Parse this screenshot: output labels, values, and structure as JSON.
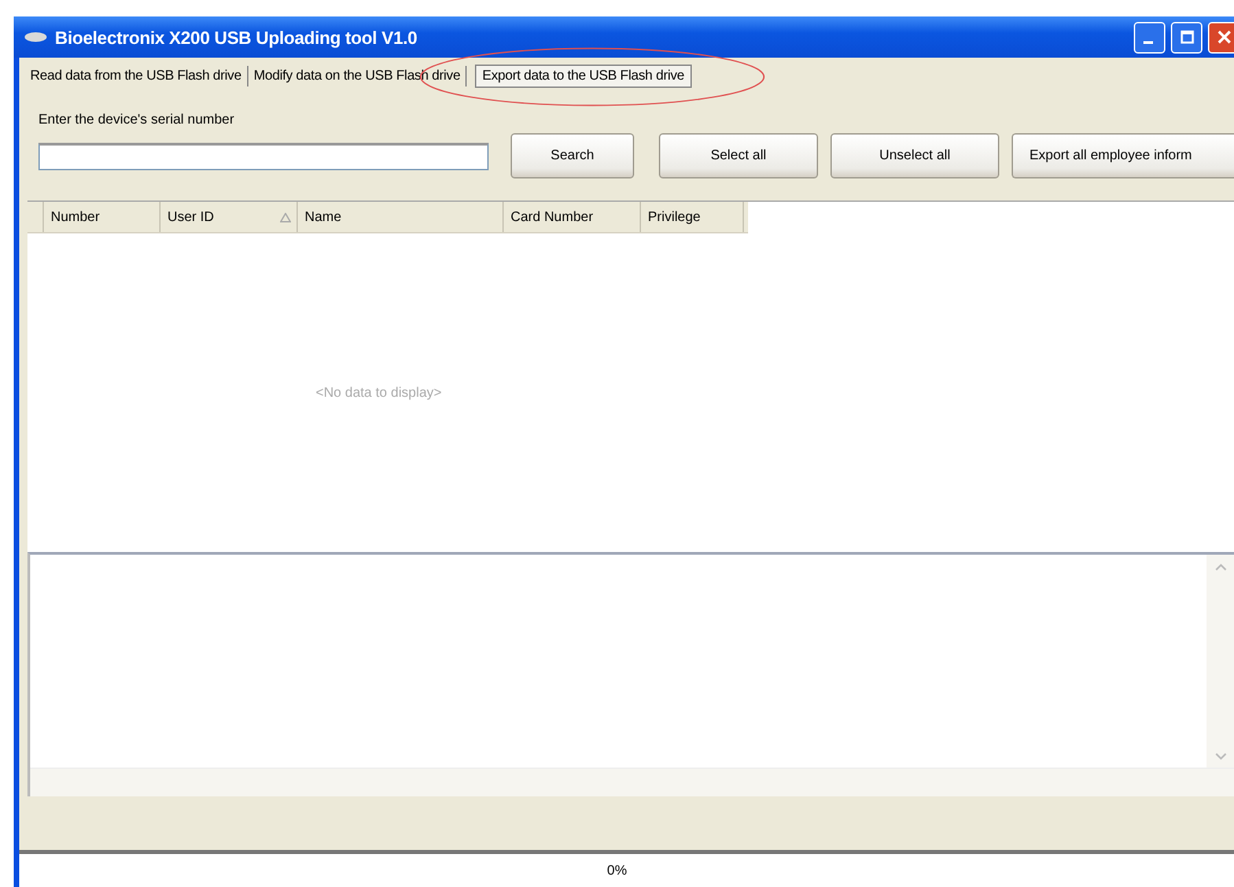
{
  "window": {
    "title": "Bioelectronix X200 USB Uploading tool V1.0"
  },
  "tabs": [
    {
      "label": "Read data from the USB Flash drive",
      "selected": false
    },
    {
      "label": "Modify data on the USB Flash drive",
      "selected": false
    },
    {
      "label": "Export data to the USB Flash drive",
      "selected": true,
      "circled": true
    }
  ],
  "serial": {
    "label": "Enter the device's serial number"
  },
  "buttons": [
    "Search",
    "Select all",
    "Unselect all",
    "Export all employee inform"
  ],
  "table": {
    "columns": [
      {
        "label": "Number",
        "sorted": false
      },
      {
        "label": "User ID",
        "sorted": true
      },
      {
        "label": "Name",
        "sorted": false
      },
      {
        "label": "Card Number",
        "sorted": false
      },
      {
        "label": "Privilege",
        "sorted": false
      }
    ],
    "empty_text": "<No data to display>"
  },
  "progress": {
    "reading": "0%"
  }
}
